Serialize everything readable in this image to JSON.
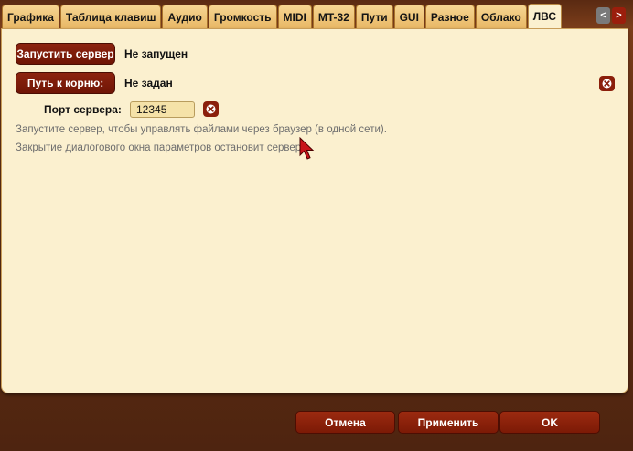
{
  "tabs": [
    {
      "label": "Графика"
    },
    {
      "label": "Таблица клавиш"
    },
    {
      "label": "Аудио"
    },
    {
      "label": "Громкость"
    },
    {
      "label": "MIDI"
    },
    {
      "label": "MT-32"
    },
    {
      "label": "Пути"
    },
    {
      "label": "GUI"
    },
    {
      "label": "Разное"
    },
    {
      "label": "Облако"
    },
    {
      "label": "ЛВС",
      "active": true
    }
  ],
  "tab_nav": {
    "prev": "<",
    "next": ">"
  },
  "server": {
    "start_button": "Запустить сервер",
    "status": "Не запущен",
    "root_path_button": "Путь к корню:",
    "root_path_value": "Не задан",
    "port_label": "Порт сервера:",
    "port_value": "12345"
  },
  "hints": {
    "line1": "Запустите сервер, чтобы управлять файлами через браузер (в одной сети).",
    "line2": "Закрытие диалогового окна параметров остановит сервер."
  },
  "footer": {
    "cancel": "Отмена",
    "apply": "Применить",
    "ok": "OK"
  },
  "colors": {
    "button": "#7f1b07",
    "panel": "#fbf0cf",
    "tab": "#efc77c",
    "nav_prev": "#7a7a7a",
    "nav_next": "#9b1e0c"
  }
}
